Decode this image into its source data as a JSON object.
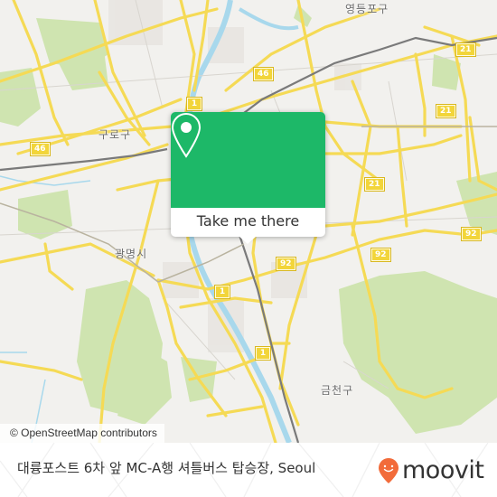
{
  "map": {
    "district_labels": [
      {
        "text": "영등포구"
      },
      {
        "text": "구로구"
      },
      {
        "text": "광명시"
      },
      {
        "text": "금천구"
      }
    ],
    "route_shields": [
      {
        "number": "46"
      },
      {
        "number": "46"
      },
      {
        "number": "1"
      },
      {
        "number": "21"
      },
      {
        "number": "21"
      },
      {
        "number": "21"
      },
      {
        "number": "92"
      },
      {
        "number": "92"
      },
      {
        "number": "92"
      },
      {
        "number": "1"
      },
      {
        "number": "1"
      }
    ],
    "attribution": "© OpenStreetMap contributors",
    "colors": {
      "background": "#f2f1ee",
      "park": "#c8e0a8",
      "road": "#f7dc5a",
      "water": "#a8d8ec",
      "rail": "#777777"
    }
  },
  "popup": {
    "icon": "location-pin-icon",
    "button_label": "Take me there",
    "accent_color": "#1db868"
  },
  "footer": {
    "title": "대륭포스트 6차 앞 MC-A행 셔틀버스 탑승장, Seoul",
    "logo_text": "moovit",
    "logo_color": "#f26b3a"
  }
}
